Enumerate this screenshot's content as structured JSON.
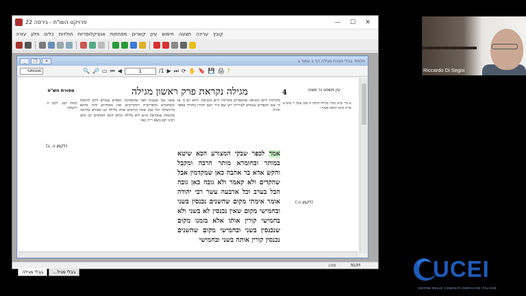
{
  "window": {
    "title": "פרויקט השו\"ת - גירסה 22",
    "controls": [
      "—",
      "☐",
      "✕"
    ]
  },
  "menubar": {
    "items": [
      "קובץ",
      "עריכה",
      "תצוגה",
      "חיפוש",
      "עיון",
      "קשרים",
      "מפתחות",
      "אנציקלופדיות",
      "תולדות",
      "כלים",
      "חלון",
      "עזרה"
    ]
  },
  "child_window": {
    "title": "תלמוד בבלי מסכת מגילה דף ב עמוד ב",
    "zoom_combo": "אוטומטי",
    "page_field": "1",
    "page_total": "/1"
  },
  "page": {
    "number": "4",
    "header": "מגילה נקראת פרק ראשון מגילה",
    "ein_mishpat_title": "עין משפט נר מצוה",
    "mesorah_title": "מסורת הש\"ס",
    "main_text": "לכפר שבקי המצורע הכא שיטא במותר ובחומרא מותר הרבה ומקבל והקש אדא בר אהבה כאן שמקדמין אבל שהקדים ולא קאמר ולא גובה כאן גובה הכל בערב וכל ארבעה עשר רבי יהודה אומר אימתי מקום שהשנים נכנסין בשני ובחמישי מקום שאין נכנסין לא בשני ולא בחמישי קורין אותו אלא בזמנו מקום שנכנסין בשני ובחמישי מקום שהשנים נכנסין קורין אותה בשני ובחמישי",
    "highlight": "אמר",
    "rashi_text": "מקדימין ליום הכניסה שהכפרים מקדימין ליום הכניסה. והוא יום ב׳ או ה׳ שבו הכפרים נכנסים לעיירות ויש שם ב״ד יושב וקורין בתורה בספר תורה",
    "tosafot_text": "אשון כמו ששנינו לפני שהסמיכה ומפרש בגמרא דלא להוסיף ומסתברא כדפרישית דמקדימים ואין מאחרים והכי איתא בירושלמי וכל שכן שאין קוראים אותו בלילה וכן מפורש בהרבה מקומות שנקראת ביום ולא בלילה קודם הזמן המוקדם וכן כתב רבינו תם בשם ר״ח גאון",
    "margin_right_text": "א מיי׳ פ״א מהל׳ מגילה הלכה ח סמג עשין ד טוש״ע או״ח סימן תרפח סעיף ו",
    "margin_left_text": "יבמות קכב. לקמן ה. ירושלמי",
    "ref_left": "(לקמן ה. ב)",
    "ref_right": "(לקמן ה:)"
  },
  "doc_tabs": [
    "בבלי מגילה",
    "בבלי מגיל..."
  ],
  "statusbar": {
    "ready": "מוכן",
    "num": "NUM"
  },
  "webcam": {
    "participant_name": "Riccardo Di Segni"
  },
  "logo": {
    "name": "UCEI",
    "tagline": "UNIONE DELLE COMUNITÀ EBRAICHE ITALIANE",
    "color": "#1e5bb8"
  }
}
